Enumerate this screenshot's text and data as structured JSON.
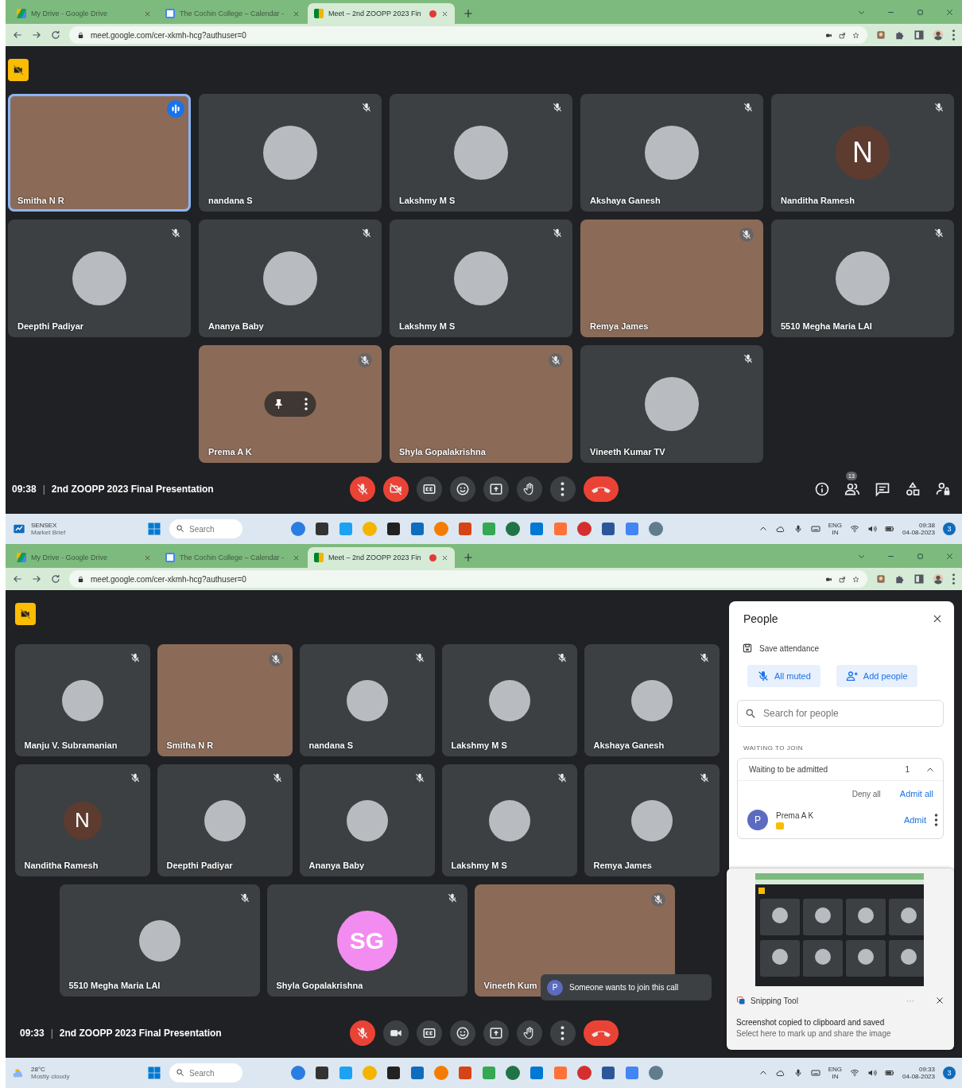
{
  "screens": [
    {
      "tabs": [
        {
          "title": "My Drive - Google Drive",
          "kind": "drive",
          "selected": false,
          "recording": false
        },
        {
          "title": "The Cochin College – Calendar -",
          "kind": "calendar",
          "selected": false,
          "recording": false
        },
        {
          "title": "Meet – 2nd ZOOPP 2023 Fin",
          "kind": "meet",
          "selected": true,
          "recording": true
        }
      ],
      "url": "meet.google.com/cer-xkmh-hcg?authuser=0",
      "tile_rows": [
        [
          {
            "name": "Smitha N R",
            "kind": "video",
            "muted": false,
            "highlighted": true,
            "hovered": false
          },
          {
            "name": "nandana S",
            "kind": "avatar",
            "muted": true,
            "highlighted": false,
            "hovered": false
          },
          {
            "name": "Lakshmy M S",
            "kind": "avatar",
            "muted": true,
            "highlighted": false,
            "hovered": false
          },
          {
            "name": "Akshaya Ganesh",
            "kind": "avatar",
            "muted": true,
            "highlighted": false,
            "hovered": false
          },
          {
            "name": "Nanditha Ramesh",
            "kind": "letter",
            "letter": "N",
            "muted": true,
            "highlighted": false,
            "hovered": false
          }
        ],
        [
          {
            "name": "Deepthi Padiyar",
            "kind": "avatar",
            "muted": true,
            "highlighted": false,
            "hovered": false
          },
          {
            "name": "Ananya Baby",
            "kind": "avatar",
            "muted": true,
            "highlighted": false,
            "hovered": false
          },
          {
            "name": "Lakshmy M S",
            "kind": "avatar",
            "muted": true,
            "highlighted": false,
            "hovered": false
          },
          {
            "name": "Remya James",
            "kind": "video",
            "muted": true,
            "highlighted": false,
            "hovered": false
          },
          {
            "name": "5510 Megha Maria LAI",
            "kind": "avatar",
            "muted": true,
            "highlighted": false,
            "hovered": false
          }
        ],
        [
          {
            "name": "Prema A K",
            "kind": "video",
            "muted": true,
            "highlighted": false,
            "hovered": true
          },
          {
            "name": "Shyla Gopalakrishna",
            "kind": "video",
            "muted": true,
            "highlighted": false,
            "hovered": false
          },
          {
            "name": "Vineeth Kumar TV",
            "kind": "avatar",
            "muted": true,
            "highlighted": false,
            "hovered": false
          }
        ]
      ],
      "call": {
        "time": "09:38",
        "separator": "|",
        "title": "2nd ZOOPP 2023 Final Presentation",
        "mic_on": false,
        "camera_on": false
      },
      "side_controls": {
        "people_count": "13"
      },
      "taskbar": {
        "widget": [
          "SENSEX",
          "Market Brief"
        ],
        "search_placeholder": "Search",
        "lang": [
          "ENG",
          "IN"
        ],
        "time": "09:38",
        "date": "04-08-2023",
        "notifications": "3"
      }
    },
    {
      "tabs": [
        {
          "title": "My Drive - Google Drive",
          "kind": "drive",
          "selected": false,
          "recording": false
        },
        {
          "title": "The Cochin College – Calendar -",
          "kind": "calendar",
          "selected": false,
          "recording": false
        },
        {
          "title": "Meet – 2nd ZOOPP 2023 Fin",
          "kind": "meet",
          "selected": true,
          "recording": true
        }
      ],
      "url": "meet.google.com/cer-xkmh-hcg?authuser=0",
      "tile_rows": [
        [
          {
            "name": "Manju V. Subramanian",
            "kind": "avatar",
            "muted": true,
            "highlighted": false,
            "hovered": false
          },
          {
            "name": "Smitha N R",
            "kind": "video",
            "muted": true,
            "highlighted": false,
            "hovered": false
          },
          {
            "name": "nandana S",
            "kind": "avatar",
            "muted": true,
            "highlighted": false,
            "hovered": false
          },
          {
            "name": "Lakshmy M S",
            "kind": "avatar",
            "muted": true,
            "highlighted": false,
            "hovered": false
          },
          {
            "name": "Akshaya Ganesh",
            "kind": "avatar",
            "muted": true,
            "highlighted": false,
            "hovered": false
          }
        ],
        [
          {
            "name": "Nanditha Ramesh",
            "kind": "letter",
            "letter": "N",
            "muted": true,
            "highlighted": false,
            "hovered": false
          },
          {
            "name": "Deepthi Padiyar",
            "kind": "avatar",
            "muted": true,
            "highlighted": false,
            "hovered": false
          },
          {
            "name": "Ananya Baby",
            "kind": "avatar",
            "muted": true,
            "highlighted": false,
            "hovered": false
          },
          {
            "name": "Lakshmy M S",
            "kind": "avatar",
            "muted": true,
            "highlighted": false,
            "hovered": false
          },
          {
            "name": "Remya James",
            "kind": "avatar",
            "muted": true,
            "highlighted": false,
            "hovered": false
          }
        ],
        [
          {
            "name": "5510 Megha Maria LAI",
            "kind": "avatar",
            "muted": true,
            "highlighted": false,
            "hovered": false
          },
          {
            "name": "Shyla Gopalakrishna",
            "kind": "initials",
            "letter": "SG",
            "muted": true,
            "highlighted": false,
            "hovered": false
          },
          {
            "name": "Vineeth Kum",
            "kind": "video",
            "muted": true,
            "highlighted": false,
            "hovered": false
          }
        ]
      ],
      "join_toast": {
        "avatar": "P",
        "text": "Someone wants to join this call"
      },
      "call": {
        "time": "09:33",
        "separator": "|",
        "title": "2nd ZOOPP 2023 Final Presentation",
        "mic_on": false,
        "camera_on": true
      },
      "people_panel": {
        "title": "People",
        "save": "Save attendance",
        "mute_all": "All muted",
        "add": "Add people",
        "search_placeholder": "Search for people",
        "section": "WAITING TO JOIN",
        "waiting_label": "Waiting to be admitted",
        "waiting_count": "1",
        "expanded": true,
        "deny_all": "Deny all",
        "admit_all": "Admit all",
        "waiting": [
          {
            "name": "Prema A K",
            "avatar": "P",
            "admit": "Admit"
          }
        ]
      },
      "snip_toast": {
        "app": "Snipping Tool",
        "more": "···",
        "title": "Screenshot copied to clipboard and saved",
        "body": "Select here to mark up and share the image"
      },
      "taskbar": {
        "widget": [
          "28°C",
          "Mostly cloudy"
        ],
        "search_placeholder": "Search",
        "lang": [
          "ENG",
          "IN"
        ],
        "time": "09:33",
        "date": "04-08-2023",
        "notifications": "3"
      }
    }
  ]
}
